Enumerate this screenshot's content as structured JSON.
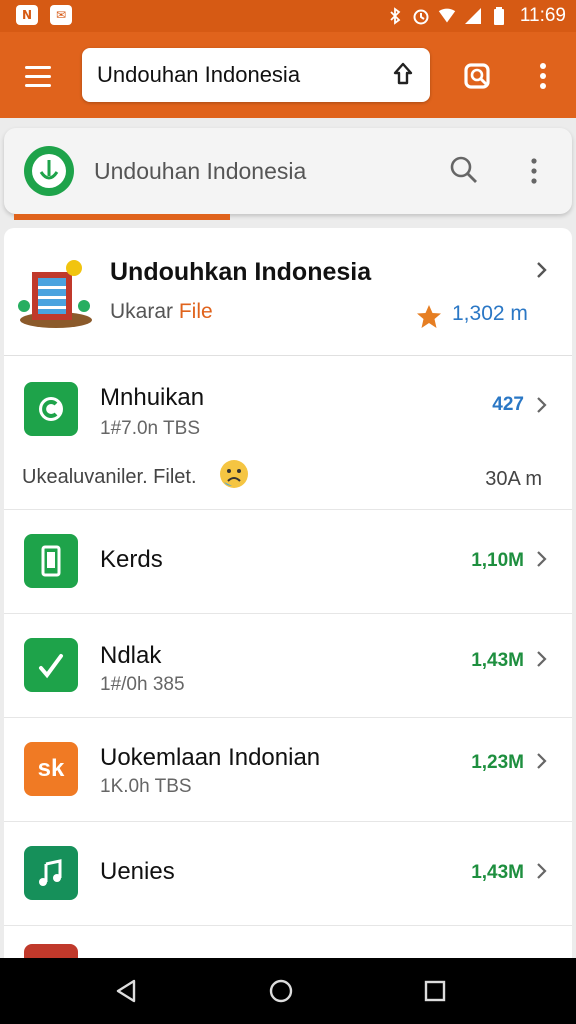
{
  "status_bar": {
    "left_icons": [
      "notification-icon",
      "notification-icon"
    ],
    "right_icons": [
      "bluetooth-icon",
      "alarm-icon",
      "wifi-icon",
      "signal-icon",
      "battery-icon"
    ],
    "time": "11:69"
  },
  "app_bar": {
    "url_text": "Undouhan Indonesia",
    "icons": [
      "menu-icon",
      "share-icon",
      "tabs-icon",
      "more-vert-icon"
    ]
  },
  "site_card": {
    "title": "Undouhan Indonesia",
    "icons": [
      "site-logo-icon",
      "search-icon",
      "more-vert-icon"
    ]
  },
  "header": {
    "title": "Undouhkan Indonesia",
    "subtitle_prefix": "Ukarar ",
    "subtitle_accent": "File",
    "stat": "1,302 m"
  },
  "rows": [
    {
      "title": "Mnhuikan",
      "subtitle": "1#7.0n TBS",
      "stat": "427",
      "stat_color": "#2a77c5",
      "icon": "chat-icon",
      "icon_color": "#1ea34a"
    },
    {
      "title": "Kerds",
      "subtitle": "",
      "stat": "1,10M",
      "stat_color": "#1e8f3f",
      "icon": "phone-icon",
      "icon_color": "#1ea34a"
    },
    {
      "title": "Ndlak",
      "subtitle": "1#/0h 385",
      "stat": "1,43M",
      "stat_color": "#1e8f3f",
      "icon": "check-icon",
      "icon_color": "#1ea34a"
    },
    {
      "title": "Uokemlaan Indonian",
      "subtitle": "1K.0h TBS",
      "stat": "1,23M",
      "stat_color": "#1e8f3f",
      "icon": "sk-icon",
      "icon_color": "#f07a24",
      "icon_label": "sk"
    },
    {
      "title": "Uenies",
      "subtitle": "",
      "stat": "1,43M",
      "stat_color": "#1e8f3f",
      "icon": "music-icon",
      "icon_color": "#16905a"
    }
  ],
  "note": {
    "text": "Ukealuvaniler. Filet.",
    "stat": "30A m",
    "emoji": "sad-face-icon"
  },
  "nav_bar": {
    "icons": [
      "back-icon",
      "home-icon",
      "recents-icon"
    ]
  },
  "colors": {
    "accent": "#e0631c",
    "status_bar": "#d65a14",
    "green": "#1ea34a",
    "blue_stat": "#2a77c5"
  }
}
